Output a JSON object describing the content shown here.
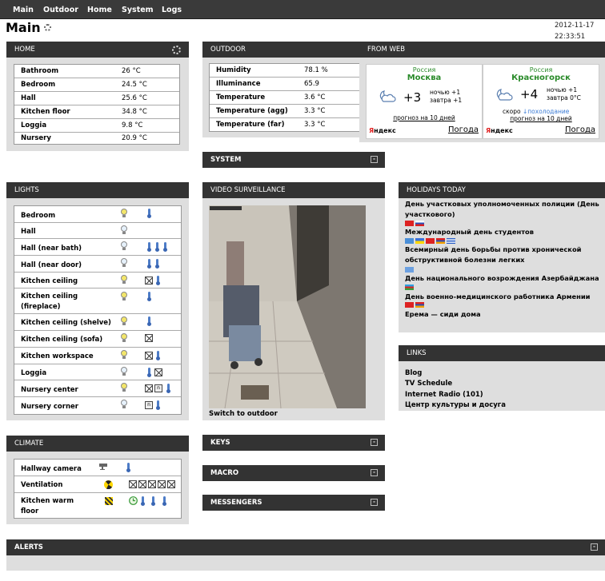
{
  "nav": {
    "items": [
      "Main",
      "Outdoor",
      "Home",
      "System",
      "Logs"
    ]
  },
  "page": {
    "title": "Main",
    "date": "2012-11-17",
    "time": "22:33:51"
  },
  "home": {
    "title": "HOME",
    "rows": [
      {
        "name": "Bathroom",
        "value": "26 °C"
      },
      {
        "name": "Bedroom",
        "value": "24.5 °C"
      },
      {
        "name": "Hall",
        "value": "25.6 °C"
      },
      {
        "name": "Kitchen floor",
        "value": "34.8 °C"
      },
      {
        "name": "Loggia",
        "value": "9.8 °C"
      },
      {
        "name": "Nursery",
        "value": "20.9 °C"
      }
    ]
  },
  "outdoor": {
    "title": "OUTDOOR",
    "rows": [
      {
        "name": "Humidity",
        "value": "78.1 %"
      },
      {
        "name": "Illuminance",
        "value": "65.9"
      },
      {
        "name": "Temperature",
        "value": "3.6 °C"
      },
      {
        "name": "Temperature (agg)",
        "value": "3.3 °C"
      },
      {
        "name": "Temperature (far)",
        "value": "3.3 °C"
      }
    ]
  },
  "system": {
    "title": "SYSTEM"
  },
  "fromweb": {
    "title": "FROM WEB",
    "widgets": [
      {
        "country": "Россия",
        "city": "Москва",
        "temp": "+3",
        "night": "ночью +1",
        "tomorrow": "завтра +1",
        "note": "",
        "trend": "",
        "forecast": "прогноз на 10 дней",
        "brand": "Яндекс",
        "weather": "Погода"
      },
      {
        "country": "Россия",
        "city": "Красногорск",
        "temp": "+4",
        "night": "ночью +1",
        "tomorrow": "завтра 0°C",
        "note": "скоро",
        "trend": "похолодание",
        "forecast": "прогноз на 10 дней",
        "brand": "Яндекс",
        "weather": "Погода"
      }
    ]
  },
  "lights": {
    "title": "LIGHTS",
    "rows": [
      {
        "name": "Bedroom",
        "bulb": "on",
        "icons": [
          "therm"
        ]
      },
      {
        "name": "Hall",
        "bulb": "off",
        "icons": []
      },
      {
        "name": "Hall (near bath)",
        "bulb": "off",
        "icons": [
          "therm",
          "therm",
          "therm"
        ]
      },
      {
        "name": "Hall (near door)",
        "bulb": "off",
        "icons": [
          "therm",
          "therm"
        ]
      },
      {
        "name": "Kitchen ceiling",
        "bulb": "on",
        "icons": [
          "x",
          "therm"
        ]
      },
      {
        "name": "Kitchen ceiling (fireplace)",
        "bulb": "on",
        "icons": [
          "therm"
        ]
      },
      {
        "name": "Kitchen ceiling (shelve)",
        "bulb": "on",
        "icons": [
          "therm"
        ]
      },
      {
        "name": "Kitchen ceiling (sofa)",
        "bulb": "on",
        "icons": [
          "x"
        ]
      },
      {
        "name": "Kitchen workspace",
        "bulb": "on",
        "icons": [
          "x",
          "therm"
        ]
      },
      {
        "name": "Loggia",
        "bulb": "off",
        "icons": [
          "therm",
          "x"
        ]
      },
      {
        "name": "Nursery center",
        "bulb": "on",
        "icons": [
          "x",
          "n",
          "therm"
        ]
      },
      {
        "name": "Nursery corner",
        "bulb": "off",
        "icons": [
          "n",
          "therm"
        ]
      }
    ]
  },
  "video": {
    "title": "VIDEO SURVEILLANCE",
    "switch_label": "Switch to outdoor"
  },
  "holidays": {
    "title": "HOLIDAYS TODAY",
    "items": [
      "День участковых уполномоченных полиции (День участкового)",
      "Международный день студентов",
      "Всемирный день борьбы против хронической обструктивной болезни легких",
      "День национального возрождения Азербайджана",
      "День военно-медицинского работника Армении",
      "Ерема — сиди дома"
    ]
  },
  "links": {
    "title": "LINKS",
    "items": [
      "Blog",
      "TV Schedule",
      "Internet Radio (101)",
      "Центр культуры и досуга"
    ]
  },
  "climate": {
    "title": "CLIMATE",
    "rows": [
      {
        "name": "Hallway camera"
      },
      {
        "name": "Ventilation"
      },
      {
        "name": "Kitchen warm floor"
      }
    ]
  },
  "collapsed": {
    "keys": "KEYS",
    "macro": "MACRO",
    "messengers": "MESSENGERS"
  },
  "alerts": {
    "title": "ALERTS"
  }
}
